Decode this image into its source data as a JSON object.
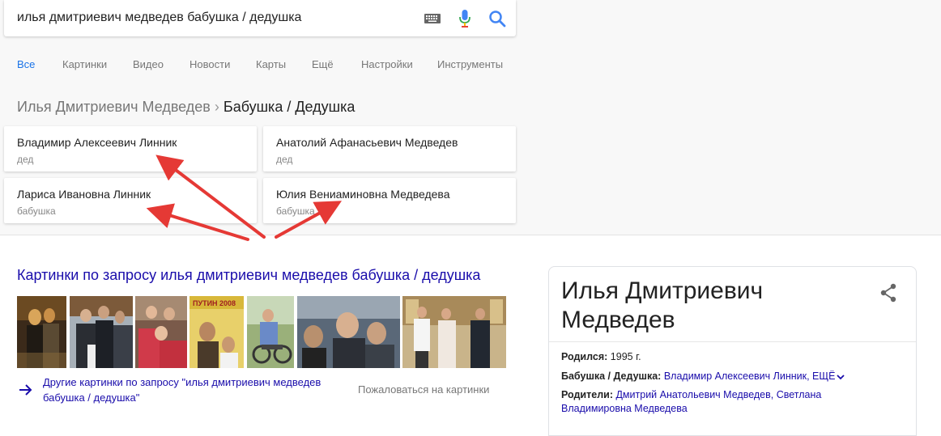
{
  "search": {
    "query": "илья дмитриевич медведев бабушка / дедушка"
  },
  "tabs": [
    {
      "label": "Все",
      "active": true
    },
    {
      "label": "Картинки"
    },
    {
      "label": "Видео"
    },
    {
      "label": "Новости"
    },
    {
      "label": "Карты"
    },
    {
      "label": "Ещё"
    },
    {
      "label": "Настройки"
    },
    {
      "label": "Инструменты"
    }
  ],
  "breadcrumb": {
    "parent": "Илья Дмитриевич Медведев",
    "separator": "›",
    "current": "Бабушка / Дедушка"
  },
  "relatives": [
    {
      "name": "Владимир Алексеевич Линник",
      "relation": "дед"
    },
    {
      "name": "Анатолий Афанасьевич Медведев",
      "relation": "дед"
    },
    {
      "name": "Лариса Ивановна Линник",
      "relation": "бабушка"
    },
    {
      "name": "Юлия Вениаминовна Медведева",
      "relation": "бабушка"
    }
  ],
  "images": {
    "heading": "Картинки по запросу илья дмитриевич медведев бабушка / дедушка",
    "thumb_book_text": "ПУТИН 2008",
    "more_link_line1": "Другие картинки по запросу \"илья дмитриевич медведев",
    "more_link_line2": "бабушка / дедушка\"",
    "report": "Пожаловаться на картинки"
  },
  "knowledge_panel": {
    "title_line1": "Илья Дмитриевич",
    "title_line2": "Медведев",
    "born_label": "Родился:",
    "born_value": "1995 г.",
    "grandparents_label": "Бабушка / Дедушка:",
    "grandparents_value": "Владимир Алексеевич Линник,",
    "grandparents_more": "ЕЩЁ",
    "parents_label": "Родители:",
    "parents_value_line1": "Дмитрий Анатольевич Медведев, Светлана",
    "parents_value_line2": "Владимировна Медведева"
  },
  "colors": {
    "link": "#1a0dab",
    "active_tab": "#1a73e8",
    "annotation_arrow": "#e53935"
  }
}
